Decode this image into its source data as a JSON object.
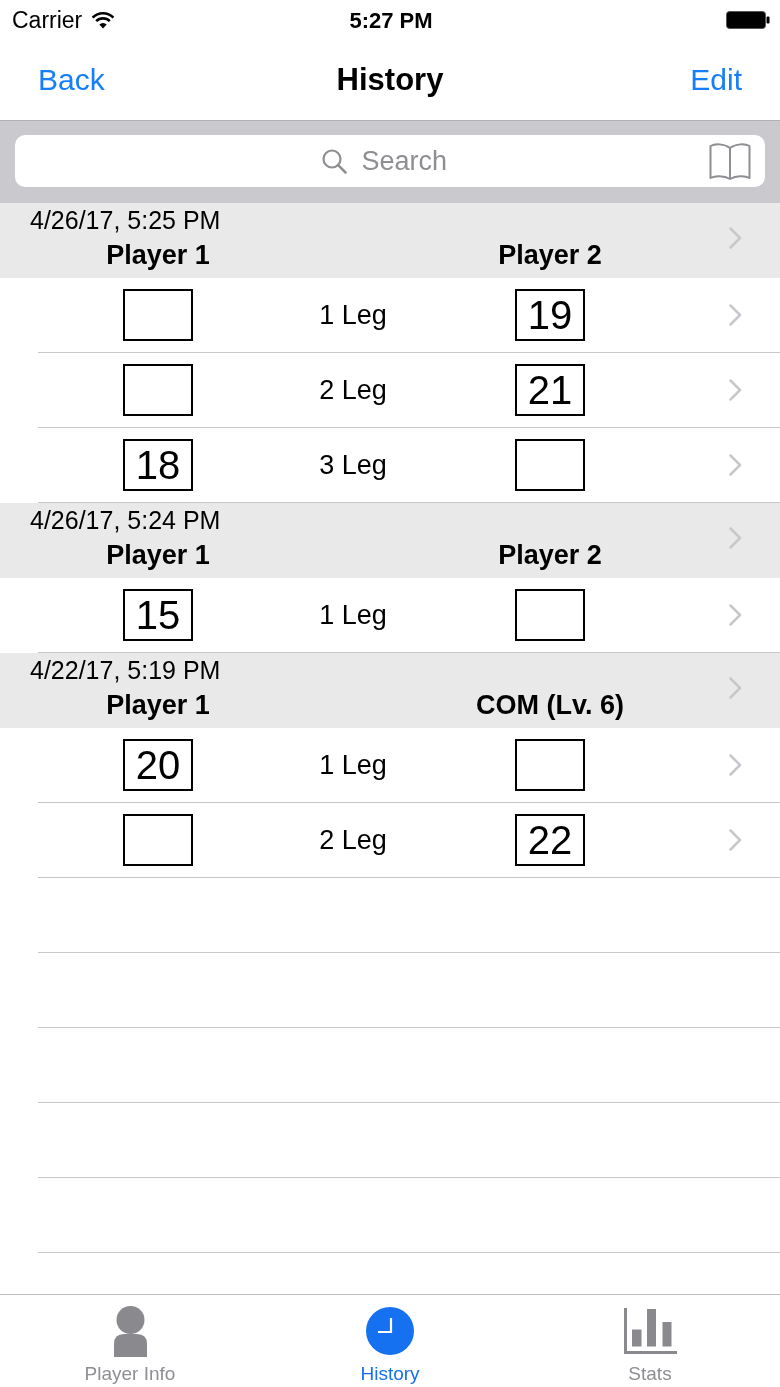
{
  "status_bar": {
    "carrier": "Carrier",
    "time": "5:27 PM"
  },
  "nav_bar": {
    "back": "Back",
    "title": "History",
    "edit": "Edit"
  },
  "search": {
    "placeholder": "Search"
  },
  "games": [
    {
      "date": "4/26/17, 5:25 PM",
      "player_1": "Player 1",
      "player_2": "Player 2",
      "legs": [
        {
          "label": "1 Leg",
          "player_2_score": "19"
        },
        {
          "label": "2 Leg",
          "player_2_score": "21"
        },
        {
          "label": "3 Leg",
          "player_1_score": "18"
        }
      ]
    },
    {
      "date": "4/26/17, 5:24 PM",
      "player_1": "Player 1",
      "player_2": "Player 2",
      "legs": [
        {
          "label": "1 Leg",
          "player_1_score": "15"
        }
      ]
    },
    {
      "date": "4/22/17, 5:19 PM",
      "player_1": "Player 1",
      "player_2": "COM (Lv. 6)",
      "legs": [
        {
          "label": "1 Leg",
          "player_1_score": "20"
        },
        {
          "label": "2 Leg",
          "player_2_score": "22"
        }
      ]
    }
  ],
  "tabs": [
    {
      "label": "Player Info",
      "selected": false
    },
    {
      "label": "History",
      "selected": true
    },
    {
      "label": "Stats",
      "selected": false
    }
  ]
}
